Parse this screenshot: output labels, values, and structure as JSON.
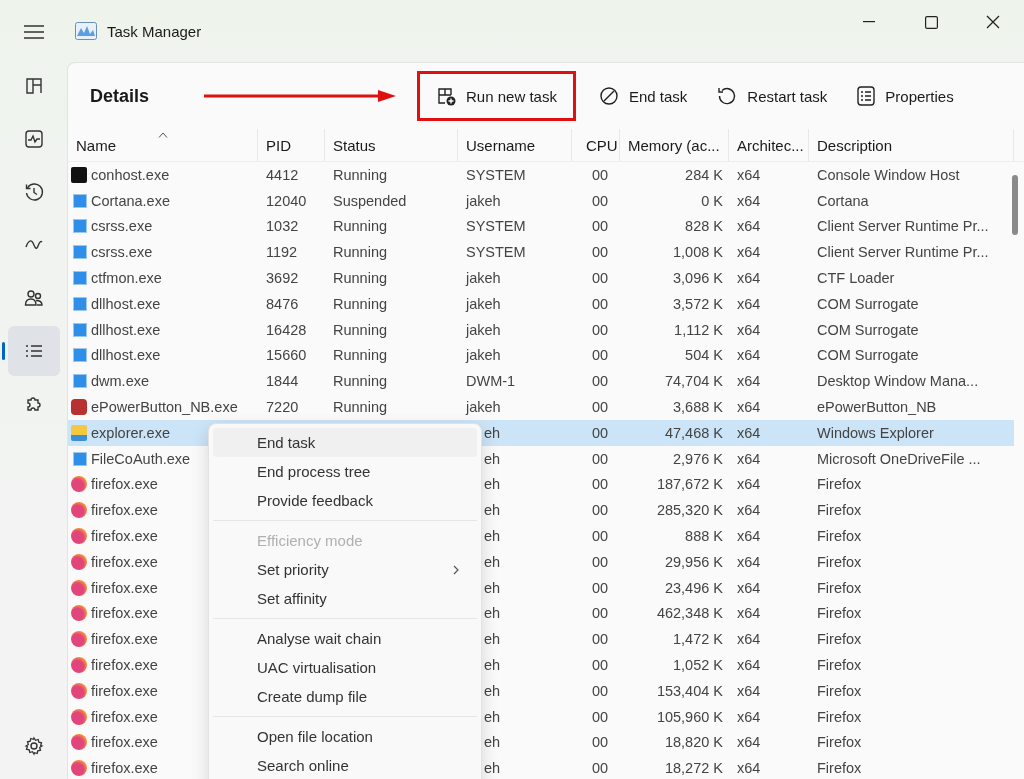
{
  "window": {
    "title": "Task Manager"
  },
  "nav": [
    {
      "selected": false
    },
    {
      "selected": false
    },
    {
      "selected": false
    },
    {
      "selected": false
    },
    {
      "selected": false
    },
    {
      "selected": true
    },
    {
      "selected": false
    }
  ],
  "page_title": "Details",
  "toolbar": [
    {
      "label": "Run new task",
      "highlighted": true
    },
    {
      "label": "End task",
      "highlighted": false
    },
    {
      "label": "Restart task",
      "highlighted": false
    },
    {
      "label": "Properties",
      "highlighted": false
    }
  ],
  "columns": [
    {
      "label": "Name",
      "sorted": true
    },
    {
      "label": "PID",
      "sorted": false
    },
    {
      "label": "Status",
      "sorted": false
    },
    {
      "label": "Username",
      "sorted": false
    },
    {
      "label": "CPU",
      "sorted": false
    },
    {
      "label": "Memory (ac...",
      "sorted": false
    },
    {
      "label": "Architec...",
      "sorted": false
    },
    {
      "label": "Description",
      "sorted": false
    }
  ],
  "rows": [
    {
      "kind": "console",
      "name": "conhost.exe",
      "pid": "4412",
      "status": "Running",
      "username": "SYSTEM",
      "cpu": "00",
      "memory": "284 K",
      "arch": "x64",
      "description": "Console Window Host",
      "selected": false
    },
    {
      "kind": "app",
      "name": "Cortana.exe",
      "pid": "12040",
      "status": "Suspended",
      "username": "jakeh",
      "cpu": "00",
      "memory": "0 K",
      "arch": "x64",
      "description": "Cortana",
      "selected": false
    },
    {
      "kind": "app",
      "name": "csrss.exe",
      "pid": "1032",
      "status": "Running",
      "username": "SYSTEM",
      "cpu": "00",
      "memory": "828 K",
      "arch": "x64",
      "description": "Client Server Runtime Pr...",
      "selected": false
    },
    {
      "kind": "app",
      "name": "csrss.exe",
      "pid": "1192",
      "status": "Running",
      "username": "SYSTEM",
      "cpu": "00",
      "memory": "1,008 K",
      "arch": "x64",
      "description": "Client Server Runtime Pr...",
      "selected": false
    },
    {
      "kind": "app",
      "name": "ctfmon.exe",
      "pid": "3692",
      "status": "Running",
      "username": "jakeh",
      "cpu": "00",
      "memory": "3,096 K",
      "arch": "x64",
      "description": "CTF Loader",
      "selected": false
    },
    {
      "kind": "app",
      "name": "dllhost.exe",
      "pid": "8476",
      "status": "Running",
      "username": "jakeh",
      "cpu": "00",
      "memory": "3,572 K",
      "arch": "x64",
      "description": "COM Surrogate",
      "selected": false
    },
    {
      "kind": "app",
      "name": "dllhost.exe",
      "pid": "16428",
      "status": "Running",
      "username": "jakeh",
      "cpu": "00",
      "memory": "1,112 K",
      "arch": "x64",
      "description": "COM Surrogate",
      "selected": false
    },
    {
      "kind": "app",
      "name": "dllhost.exe",
      "pid": "15660",
      "status": "Running",
      "username": "jakeh",
      "cpu": "00",
      "memory": "504 K",
      "arch": "x64",
      "description": "COM Surrogate",
      "selected": false
    },
    {
      "kind": "app",
      "name": "dwm.exe",
      "pid": "1844",
      "status": "Running",
      "username": "DWM-1",
      "cpu": "00",
      "memory": "74,704 K",
      "arch": "x64",
      "description": "Desktop Window Mana...",
      "selected": false
    },
    {
      "kind": "power",
      "name": "ePowerButton_NB.exe",
      "pid": "7220",
      "status": "Running",
      "username": "jakeh",
      "cpu": "00",
      "memory": "3,688 K",
      "arch": "x64",
      "description": "ePowerButton_NB",
      "selected": false
    },
    {
      "kind": "folder",
      "name": "explorer.exe",
      "username": "eh",
      "cpu": "00",
      "memory": "47,468 K",
      "arch": "x64",
      "description": "Windows Explorer",
      "selected": true
    },
    {
      "kind": "app",
      "name": "FileCoAuth.exe",
      "username": "eh",
      "cpu": "00",
      "memory": "2,976 K",
      "arch": "x64",
      "description": "Microsoft OneDriveFile ...",
      "selected": false
    },
    {
      "kind": "firefox",
      "name": "firefox.exe",
      "username": "eh",
      "cpu": "00",
      "memory": "187,672 K",
      "arch": "x64",
      "description": "Firefox",
      "selected": false
    },
    {
      "kind": "firefox",
      "name": "firefox.exe",
      "username": "eh",
      "cpu": "00",
      "memory": "285,320 K",
      "arch": "x64",
      "description": "Firefox",
      "selected": false
    },
    {
      "kind": "firefox",
      "name": "firefox.exe",
      "username": "eh",
      "cpu": "00",
      "memory": "888 K",
      "arch": "x64",
      "description": "Firefox",
      "selected": false
    },
    {
      "kind": "firefox",
      "name": "firefox.exe",
      "username": "eh",
      "cpu": "00",
      "memory": "29,956 K",
      "arch": "x64",
      "description": "Firefox",
      "selected": false
    },
    {
      "kind": "firefox",
      "name": "firefox.exe",
      "username": "eh",
      "cpu": "00",
      "memory": "23,496 K",
      "arch": "x64",
      "description": "Firefox",
      "selected": false
    },
    {
      "kind": "firefox",
      "name": "firefox.exe",
      "username": "eh",
      "cpu": "00",
      "memory": "462,348 K",
      "arch": "x64",
      "description": "Firefox",
      "selected": false
    },
    {
      "kind": "firefox",
      "name": "firefox.exe",
      "username": "eh",
      "cpu": "00",
      "memory": "1,472 K",
      "arch": "x64",
      "description": "Firefox",
      "selected": false
    },
    {
      "kind": "firefox",
      "name": "firefox.exe",
      "username": "eh",
      "cpu": "00",
      "memory": "1,052 K",
      "arch": "x64",
      "description": "Firefox",
      "selected": false
    },
    {
      "kind": "firefox",
      "name": "firefox.exe",
      "username": "eh",
      "cpu": "00",
      "memory": "153,404 K",
      "arch": "x64",
      "description": "Firefox",
      "selected": false
    },
    {
      "kind": "firefox",
      "name": "firefox.exe",
      "username": "eh",
      "cpu": "00",
      "memory": "105,960 K",
      "arch": "x64",
      "description": "Firefox",
      "selected": false
    },
    {
      "kind": "firefox",
      "name": "firefox.exe",
      "username": "eh",
      "cpu": "00",
      "memory": "18,820 K",
      "arch": "x64",
      "description": "Firefox",
      "selected": false
    },
    {
      "kind": "firefox",
      "name": "firefox.exe",
      "username": "eh",
      "cpu": "00",
      "memory": "18,272 K",
      "arch": "x64",
      "description": "Firefox",
      "selected": false
    }
  ],
  "context_menu": [
    {
      "kind": "item",
      "label": "End task",
      "disabled": false,
      "submenu": false
    },
    {
      "kind": "item",
      "label": "End process tree",
      "disabled": false,
      "submenu": false
    },
    {
      "kind": "item",
      "label": "Provide feedback",
      "disabled": false,
      "submenu": false
    },
    {
      "kind": "separator"
    },
    {
      "kind": "item",
      "label": "Efficiency mode",
      "disabled": true,
      "submenu": false
    },
    {
      "kind": "item",
      "label": "Set priority",
      "disabled": false,
      "submenu": true
    },
    {
      "kind": "item",
      "label": "Set affinity",
      "disabled": false,
      "submenu": false
    },
    {
      "kind": "separator"
    },
    {
      "kind": "item",
      "label": "Analyse wait chain",
      "disabled": false,
      "submenu": false
    },
    {
      "kind": "item",
      "label": "UAC virtualisation",
      "disabled": false,
      "submenu": false
    },
    {
      "kind": "item",
      "label": "Create dump file",
      "disabled": false,
      "submenu": false
    },
    {
      "kind": "separator"
    },
    {
      "kind": "item",
      "label": "Open file location",
      "disabled": false,
      "submenu": false
    },
    {
      "kind": "item",
      "label": "Search online",
      "disabled": false,
      "submenu": false
    }
  ]
}
